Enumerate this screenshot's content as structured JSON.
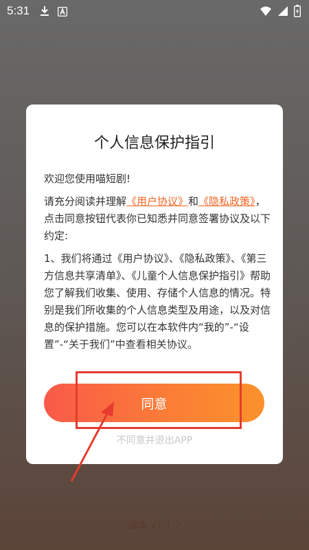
{
  "status_bar": {
    "time": "5:31",
    "icons": [
      "download-icon",
      "a-icon",
      "wifi-icon",
      "signal-icon",
      "battery-icon"
    ]
  },
  "dialog": {
    "title": "个人信息保护指引",
    "welcome": "欢迎您使用喵短剧!",
    "intro_before": "请充分阅读并理解",
    "link_user_agreement": "《用户协议》",
    "intro_and": "和",
    "link_privacy_policy": "《隐私政策》",
    "intro_after": "，点击同意按钮代表你已知悉并同意签署协议及以下约定:",
    "clause_1": "1、我们将通过《用户协议》、《隐私政策》、《第三方信息共享清单》、《儿童个人信息保护指引》帮助您了解我们收集、使用、存储个人信息的情况。特别是我们所收集的个人信息类型及用途，以及对信息的保护措施。您可以在本软件内“我的”-“设置”-“关于我们”中查看相关协议。",
    "agree_label": "同意",
    "disagree_label": "不同意并退出APP"
  },
  "version_text": "版本 v1.1.2",
  "colors": {
    "accent": "#f26522",
    "button_start": "#f95a4a",
    "button_end": "#fb922c",
    "annotation": "#e63b2e"
  }
}
